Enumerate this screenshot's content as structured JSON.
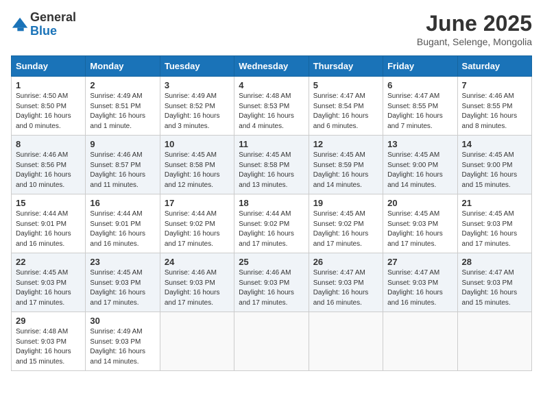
{
  "logo": {
    "general": "General",
    "blue": "Blue"
  },
  "title": "June 2025",
  "subtitle": "Bugant, Selenge, Mongolia",
  "days_of_week": [
    "Sunday",
    "Monday",
    "Tuesday",
    "Wednesday",
    "Thursday",
    "Friday",
    "Saturday"
  ],
  "weeks": [
    [
      {
        "day": "1",
        "sunrise": "4:50 AM",
        "sunset": "8:50 PM",
        "daylight": "16 hours and 0 minutes."
      },
      {
        "day": "2",
        "sunrise": "4:49 AM",
        "sunset": "8:51 PM",
        "daylight": "16 hours and 1 minute."
      },
      {
        "day": "3",
        "sunrise": "4:49 AM",
        "sunset": "8:52 PM",
        "daylight": "16 hours and 3 minutes."
      },
      {
        "day": "4",
        "sunrise": "4:48 AM",
        "sunset": "8:53 PM",
        "daylight": "16 hours and 4 minutes."
      },
      {
        "day": "5",
        "sunrise": "4:47 AM",
        "sunset": "8:54 PM",
        "daylight": "16 hours and 6 minutes."
      },
      {
        "day": "6",
        "sunrise": "4:47 AM",
        "sunset": "8:55 PM",
        "daylight": "16 hours and 7 minutes."
      },
      {
        "day": "7",
        "sunrise": "4:46 AM",
        "sunset": "8:55 PM",
        "daylight": "16 hours and 8 minutes."
      }
    ],
    [
      {
        "day": "8",
        "sunrise": "4:46 AM",
        "sunset": "8:56 PM",
        "daylight": "16 hours and 10 minutes."
      },
      {
        "day": "9",
        "sunrise": "4:46 AM",
        "sunset": "8:57 PM",
        "daylight": "16 hours and 11 minutes."
      },
      {
        "day": "10",
        "sunrise": "4:45 AM",
        "sunset": "8:58 PM",
        "daylight": "16 hours and 12 minutes."
      },
      {
        "day": "11",
        "sunrise": "4:45 AM",
        "sunset": "8:58 PM",
        "daylight": "16 hours and 13 minutes."
      },
      {
        "day": "12",
        "sunrise": "4:45 AM",
        "sunset": "8:59 PM",
        "daylight": "16 hours and 14 minutes."
      },
      {
        "day": "13",
        "sunrise": "4:45 AM",
        "sunset": "9:00 PM",
        "daylight": "16 hours and 14 minutes."
      },
      {
        "day": "14",
        "sunrise": "4:45 AM",
        "sunset": "9:00 PM",
        "daylight": "16 hours and 15 minutes."
      }
    ],
    [
      {
        "day": "15",
        "sunrise": "4:44 AM",
        "sunset": "9:01 PM",
        "daylight": "16 hours and 16 minutes."
      },
      {
        "day": "16",
        "sunrise": "4:44 AM",
        "sunset": "9:01 PM",
        "daylight": "16 hours and 16 minutes."
      },
      {
        "day": "17",
        "sunrise": "4:44 AM",
        "sunset": "9:02 PM",
        "daylight": "16 hours and 17 minutes."
      },
      {
        "day": "18",
        "sunrise": "4:44 AM",
        "sunset": "9:02 PM",
        "daylight": "16 hours and 17 minutes."
      },
      {
        "day": "19",
        "sunrise": "4:45 AM",
        "sunset": "9:02 PM",
        "daylight": "16 hours and 17 minutes."
      },
      {
        "day": "20",
        "sunrise": "4:45 AM",
        "sunset": "9:03 PM",
        "daylight": "16 hours and 17 minutes."
      },
      {
        "day": "21",
        "sunrise": "4:45 AM",
        "sunset": "9:03 PM",
        "daylight": "16 hours and 17 minutes."
      }
    ],
    [
      {
        "day": "22",
        "sunrise": "4:45 AM",
        "sunset": "9:03 PM",
        "daylight": "16 hours and 17 minutes."
      },
      {
        "day": "23",
        "sunrise": "4:45 AM",
        "sunset": "9:03 PM",
        "daylight": "16 hours and 17 minutes."
      },
      {
        "day": "24",
        "sunrise": "4:46 AM",
        "sunset": "9:03 PM",
        "daylight": "16 hours and 17 minutes."
      },
      {
        "day": "25",
        "sunrise": "4:46 AM",
        "sunset": "9:03 PM",
        "daylight": "16 hours and 17 minutes."
      },
      {
        "day": "26",
        "sunrise": "4:47 AM",
        "sunset": "9:03 PM",
        "daylight": "16 hours and 16 minutes."
      },
      {
        "day": "27",
        "sunrise": "4:47 AM",
        "sunset": "9:03 PM",
        "daylight": "16 hours and 16 minutes."
      },
      {
        "day": "28",
        "sunrise": "4:47 AM",
        "sunset": "9:03 PM",
        "daylight": "16 hours and 15 minutes."
      }
    ],
    [
      {
        "day": "29",
        "sunrise": "4:48 AM",
        "sunset": "9:03 PM",
        "daylight": "16 hours and 15 minutes."
      },
      {
        "day": "30",
        "sunrise": "4:49 AM",
        "sunset": "9:03 PM",
        "daylight": "16 hours and 14 minutes."
      },
      null,
      null,
      null,
      null,
      null
    ]
  ]
}
